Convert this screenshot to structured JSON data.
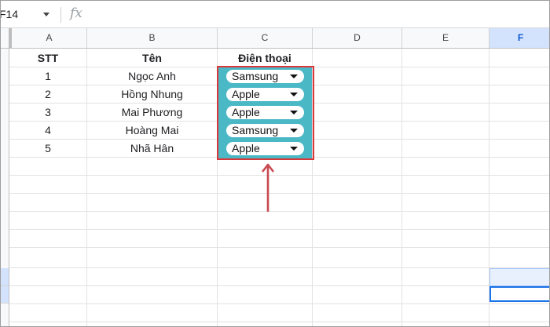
{
  "name_box": {
    "cell_ref": "F14"
  },
  "formula_bar": {
    "fx_label": "fx"
  },
  "columns": [
    "A",
    "B",
    "C",
    "D",
    "E",
    "F"
  ],
  "table": {
    "headers": {
      "stt": "STT",
      "ten": "Tên",
      "dien_thoai": "Điện thoại"
    },
    "rows": [
      {
        "stt": "1",
        "ten": "Ngọc Anh",
        "dien_thoai": "Samsung"
      },
      {
        "stt": "2",
        "ten": "Hồng Nhung",
        "dien_thoai": "Apple"
      },
      {
        "stt": "3",
        "ten": "Mai Phương",
        "dien_thoai": "Apple"
      },
      {
        "stt": "4",
        "ten": "Hoàng Mai",
        "dien_thoai": "Samsung"
      },
      {
        "stt": "5",
        "ten": "Nhã Hân",
        "dien_thoai": "Apple"
      }
    ]
  },
  "colors": {
    "dropdown_fill": "#4bb8c6",
    "highlight_border": "#d9383a",
    "arrow": "#c94a50",
    "selection": "#1a73e8"
  },
  "icons": {
    "name_box_dropdown": "chevron-down-icon",
    "formula": "fx-icon",
    "chip_dropdown": "caret-down-icon",
    "annotation": "arrow-up-icon"
  }
}
